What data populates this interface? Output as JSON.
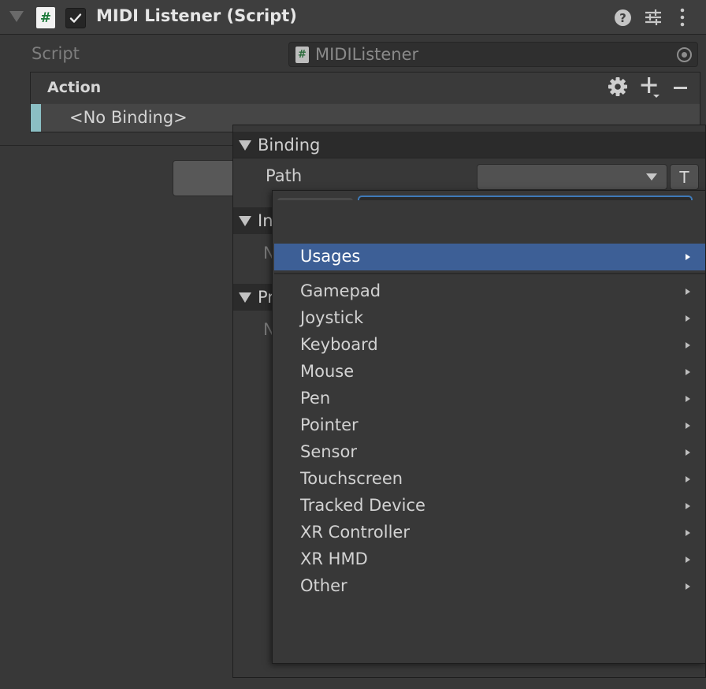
{
  "component": {
    "title": "MIDI Listener (Script)",
    "enabled": true,
    "script_icon_glyph": "#",
    "header_icons": [
      "help-icon",
      "presets-icon",
      "kebab-menu-icon"
    ]
  },
  "script_field": {
    "label": "Script",
    "value": "MIDIListener",
    "icon_glyph": "#"
  },
  "action_list": {
    "title": "Action",
    "toolbar_icons": [
      "gear-icon",
      "add-icon",
      "remove-icon"
    ],
    "rows": [
      {
        "label": "<No Binding>",
        "marker_color": "#8bbfc4"
      }
    ]
  },
  "binding_panel": {
    "binding_section": "Binding",
    "path_label": "Path",
    "path_value": "",
    "text_mode_label": "T",
    "interactions_section": "In",
    "interactions_empty": "N",
    "processors_section": "Pr",
    "processors_empty": "N"
  },
  "control_picker": {
    "search_value": "",
    "accent_color": "#3f7ab8",
    "selected_color": "#3d5f96",
    "usages_item": {
      "label": "Usages",
      "has_submenu": true
    },
    "items": [
      {
        "label": "Gamepad",
        "has_submenu": true
      },
      {
        "label": "Joystick",
        "has_submenu": true
      },
      {
        "label": "Keyboard",
        "has_submenu": true
      },
      {
        "label": "Mouse",
        "has_submenu": true
      },
      {
        "label": "Pen",
        "has_submenu": true
      },
      {
        "label": "Pointer",
        "has_submenu": true
      },
      {
        "label": "Sensor",
        "has_submenu": true
      },
      {
        "label": "Touchscreen",
        "has_submenu": true
      },
      {
        "label": "Tracked Device",
        "has_submenu": true
      },
      {
        "label": "XR Controller",
        "has_submenu": true
      },
      {
        "label": "XR HMD",
        "has_submenu": true
      },
      {
        "label": "Other",
        "has_submenu": true
      }
    ]
  }
}
